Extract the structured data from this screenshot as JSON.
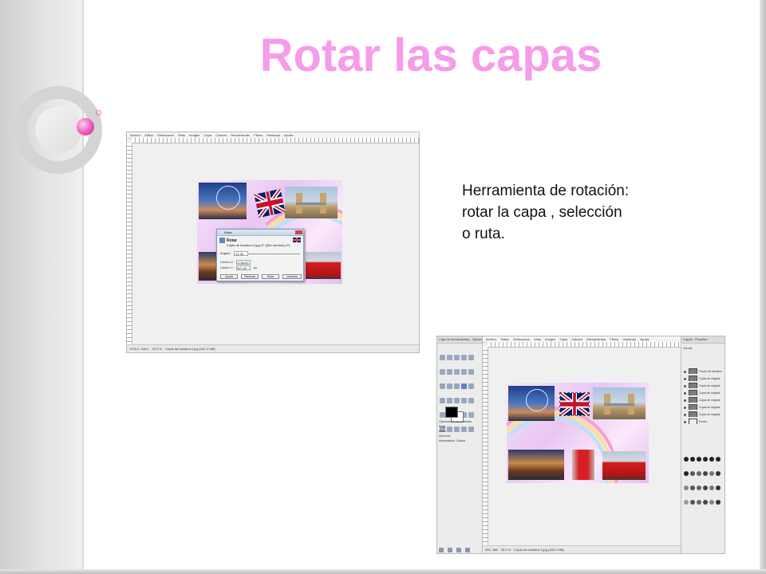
{
  "slide": {
    "title": "Rotar las capas",
    "caption_lines": [
      "Herramienta de rotación:",
      "rotar la capa , selección",
      "o ruta."
    ]
  },
  "screenshot1": {
    "menu": [
      "Archivo",
      "Editar",
      "Seleccionar",
      "Vista",
      "Imagen",
      "Capa",
      "Colores",
      "Herramientas",
      "Filtros",
      "Ventanas",
      "Ayuda"
    ],
    "status_coords": "1703.0, 945.0",
    "status_zoom": "33.3 %",
    "status_text": "Copia de bandera 2.jpg (187.4 MB)",
    "dialog": {
      "window_title": "Rotar",
      "heading": "Rotar",
      "subtitle": "Copia de bandera 2.jpg-47 ([Sin nombre]-47)",
      "angle_label": "Ángulo:",
      "angle_value": "-12.30",
      "center_x_label": "Centro X:",
      "center_x_value": "1736.00",
      "center_y_label": "Centro Y:",
      "center_y_value": "317.00",
      "unit": "px",
      "buttons": [
        "Ayuda",
        "Reiniciar",
        "Rotar",
        "Cancelar"
      ]
    }
  },
  "screenshot2": {
    "toolbox_title": "Caja de herramientas - Opcion...",
    "tool_options_title": "Opciones de herramientas",
    "tool_options": [
      "Rotar",
      "Modo",
      "Dirección",
      "Interpolación: Cúbica"
    ],
    "menu": [
      "Archivo",
      "Editar",
      "Seleccionar",
      "Vista",
      "Imagen",
      "Capa",
      "Colores",
      "Herramientas",
      "Filtros",
      "Ventanas",
      "Ayuda"
    ],
    "layers_title": "Capas - Pinceles",
    "layer_mode": "Normal",
    "layers": [
      "Fondo de bandera",
      "Copia de original",
      "Copia de original",
      "Copia de original",
      "Copia de original",
      "Copia de original",
      "Copia de original",
      "Fondo"
    ],
    "status_coords": "390, 388",
    "status_zoom": "33.3 %",
    "status_text": "Copia de bandera 2.jpg (180.1 MB)"
  },
  "colors": {
    "title": "#f69ce8",
    "accent_ball": "#f06cc6"
  }
}
